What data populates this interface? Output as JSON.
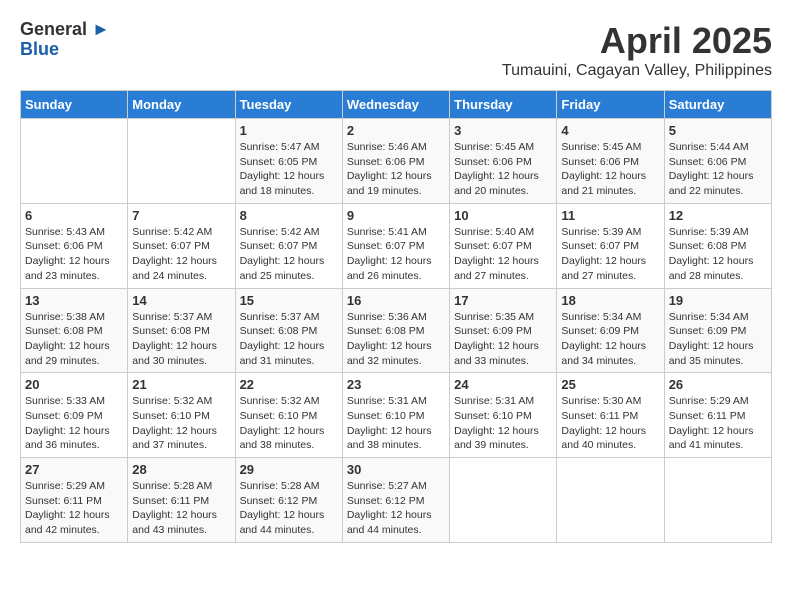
{
  "logo": {
    "general": "General",
    "blue": "Blue"
  },
  "title": {
    "month": "April 2025",
    "location": "Tumauini, Cagayan Valley, Philippines"
  },
  "days_of_week": [
    "Sunday",
    "Monday",
    "Tuesday",
    "Wednesday",
    "Thursday",
    "Friday",
    "Saturday"
  ],
  "weeks": [
    [
      {
        "day": "",
        "sunrise": "",
        "sunset": "",
        "daylight": ""
      },
      {
        "day": "",
        "sunrise": "",
        "sunset": "",
        "daylight": ""
      },
      {
        "day": "1",
        "sunrise": "Sunrise: 5:47 AM",
        "sunset": "Sunset: 6:05 PM",
        "daylight": "Daylight: 12 hours and 18 minutes."
      },
      {
        "day": "2",
        "sunrise": "Sunrise: 5:46 AM",
        "sunset": "Sunset: 6:06 PM",
        "daylight": "Daylight: 12 hours and 19 minutes."
      },
      {
        "day": "3",
        "sunrise": "Sunrise: 5:45 AM",
        "sunset": "Sunset: 6:06 PM",
        "daylight": "Daylight: 12 hours and 20 minutes."
      },
      {
        "day": "4",
        "sunrise": "Sunrise: 5:45 AM",
        "sunset": "Sunset: 6:06 PM",
        "daylight": "Daylight: 12 hours and 21 minutes."
      },
      {
        "day": "5",
        "sunrise": "Sunrise: 5:44 AM",
        "sunset": "Sunset: 6:06 PM",
        "daylight": "Daylight: 12 hours and 22 minutes."
      }
    ],
    [
      {
        "day": "6",
        "sunrise": "Sunrise: 5:43 AM",
        "sunset": "Sunset: 6:06 PM",
        "daylight": "Daylight: 12 hours and 23 minutes."
      },
      {
        "day": "7",
        "sunrise": "Sunrise: 5:42 AM",
        "sunset": "Sunset: 6:07 PM",
        "daylight": "Daylight: 12 hours and 24 minutes."
      },
      {
        "day": "8",
        "sunrise": "Sunrise: 5:42 AM",
        "sunset": "Sunset: 6:07 PM",
        "daylight": "Daylight: 12 hours and 25 minutes."
      },
      {
        "day": "9",
        "sunrise": "Sunrise: 5:41 AM",
        "sunset": "Sunset: 6:07 PM",
        "daylight": "Daylight: 12 hours and 26 minutes."
      },
      {
        "day": "10",
        "sunrise": "Sunrise: 5:40 AM",
        "sunset": "Sunset: 6:07 PM",
        "daylight": "Daylight: 12 hours and 27 minutes."
      },
      {
        "day": "11",
        "sunrise": "Sunrise: 5:39 AM",
        "sunset": "Sunset: 6:07 PM",
        "daylight": "Daylight: 12 hours and 27 minutes."
      },
      {
        "day": "12",
        "sunrise": "Sunrise: 5:39 AM",
        "sunset": "Sunset: 6:08 PM",
        "daylight": "Daylight: 12 hours and 28 minutes."
      }
    ],
    [
      {
        "day": "13",
        "sunrise": "Sunrise: 5:38 AM",
        "sunset": "Sunset: 6:08 PM",
        "daylight": "Daylight: 12 hours and 29 minutes."
      },
      {
        "day": "14",
        "sunrise": "Sunrise: 5:37 AM",
        "sunset": "Sunset: 6:08 PM",
        "daylight": "Daylight: 12 hours and 30 minutes."
      },
      {
        "day": "15",
        "sunrise": "Sunrise: 5:37 AM",
        "sunset": "Sunset: 6:08 PM",
        "daylight": "Daylight: 12 hours and 31 minutes."
      },
      {
        "day": "16",
        "sunrise": "Sunrise: 5:36 AM",
        "sunset": "Sunset: 6:08 PM",
        "daylight": "Daylight: 12 hours and 32 minutes."
      },
      {
        "day": "17",
        "sunrise": "Sunrise: 5:35 AM",
        "sunset": "Sunset: 6:09 PM",
        "daylight": "Daylight: 12 hours and 33 minutes."
      },
      {
        "day": "18",
        "sunrise": "Sunrise: 5:34 AM",
        "sunset": "Sunset: 6:09 PM",
        "daylight": "Daylight: 12 hours and 34 minutes."
      },
      {
        "day": "19",
        "sunrise": "Sunrise: 5:34 AM",
        "sunset": "Sunset: 6:09 PM",
        "daylight": "Daylight: 12 hours and 35 minutes."
      }
    ],
    [
      {
        "day": "20",
        "sunrise": "Sunrise: 5:33 AM",
        "sunset": "Sunset: 6:09 PM",
        "daylight": "Daylight: 12 hours and 36 minutes."
      },
      {
        "day": "21",
        "sunrise": "Sunrise: 5:32 AM",
        "sunset": "Sunset: 6:10 PM",
        "daylight": "Daylight: 12 hours and 37 minutes."
      },
      {
        "day": "22",
        "sunrise": "Sunrise: 5:32 AM",
        "sunset": "Sunset: 6:10 PM",
        "daylight": "Daylight: 12 hours and 38 minutes."
      },
      {
        "day": "23",
        "sunrise": "Sunrise: 5:31 AM",
        "sunset": "Sunset: 6:10 PM",
        "daylight": "Daylight: 12 hours and 38 minutes."
      },
      {
        "day": "24",
        "sunrise": "Sunrise: 5:31 AM",
        "sunset": "Sunset: 6:10 PM",
        "daylight": "Daylight: 12 hours and 39 minutes."
      },
      {
        "day": "25",
        "sunrise": "Sunrise: 5:30 AM",
        "sunset": "Sunset: 6:11 PM",
        "daylight": "Daylight: 12 hours and 40 minutes."
      },
      {
        "day": "26",
        "sunrise": "Sunrise: 5:29 AM",
        "sunset": "Sunset: 6:11 PM",
        "daylight": "Daylight: 12 hours and 41 minutes."
      }
    ],
    [
      {
        "day": "27",
        "sunrise": "Sunrise: 5:29 AM",
        "sunset": "Sunset: 6:11 PM",
        "daylight": "Daylight: 12 hours and 42 minutes."
      },
      {
        "day": "28",
        "sunrise": "Sunrise: 5:28 AM",
        "sunset": "Sunset: 6:11 PM",
        "daylight": "Daylight: 12 hours and 43 minutes."
      },
      {
        "day": "29",
        "sunrise": "Sunrise: 5:28 AM",
        "sunset": "Sunset: 6:12 PM",
        "daylight": "Daylight: 12 hours and 44 minutes."
      },
      {
        "day": "30",
        "sunrise": "Sunrise: 5:27 AM",
        "sunset": "Sunset: 6:12 PM",
        "daylight": "Daylight: 12 hours and 44 minutes."
      },
      {
        "day": "",
        "sunrise": "",
        "sunset": "",
        "daylight": ""
      },
      {
        "day": "",
        "sunrise": "",
        "sunset": "",
        "daylight": ""
      },
      {
        "day": "",
        "sunrise": "",
        "sunset": "",
        "daylight": ""
      }
    ]
  ]
}
